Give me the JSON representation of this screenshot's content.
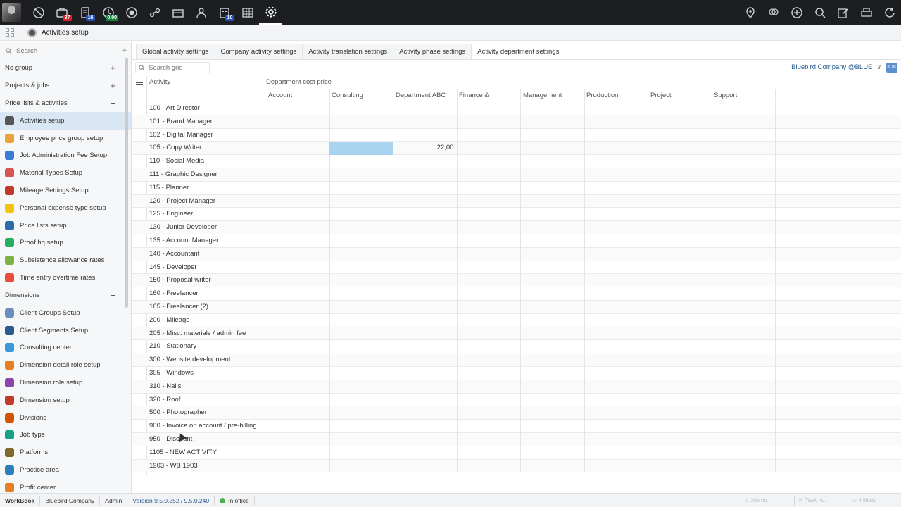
{
  "topbar": {
    "left_icons": [
      {
        "name": "dashboard-icon",
        "badge": "",
        "badge_color": ""
      },
      {
        "name": "jobs-icon",
        "badge": "37",
        "badge_color": "red"
      },
      {
        "name": "tasks-icon",
        "badge": "16",
        "badge_color": "blue"
      },
      {
        "name": "time-icon",
        "badge": "0,00",
        "badge_color": "green"
      },
      {
        "name": "target-icon",
        "badge": "",
        "badge_color": ""
      },
      {
        "name": "flow-icon",
        "badge": "",
        "badge_color": ""
      },
      {
        "name": "briefcase-icon",
        "badge": "",
        "badge_color": ""
      },
      {
        "name": "people-icon",
        "badge": "",
        "badge_color": ""
      },
      {
        "name": "building-icon",
        "badge": "10",
        "badge_color": "blue"
      },
      {
        "name": "table-icon",
        "badge": "",
        "badge_color": ""
      },
      {
        "name": "gear-icon",
        "badge": "",
        "badge_color": ""
      }
    ],
    "right_icons": [
      "location-icon",
      "brain-icon",
      "add-icon",
      "search-icon",
      "edit-icon",
      "print-icon",
      "refresh-icon"
    ]
  },
  "subbar": {
    "title": "Activities setup"
  },
  "sidebar": {
    "search_placeholder": "Search",
    "groups": [
      {
        "label": "No group",
        "toggle": "+",
        "items": []
      },
      {
        "label": "Projects & jobs",
        "toggle": "+",
        "items": []
      },
      {
        "label": "Price lists & activities",
        "toggle": "−",
        "items": [
          {
            "label": "Activities setup",
            "color": "#555555",
            "selected": true
          },
          {
            "label": "Employee price group setup",
            "color": "#e8a33a",
            "selected": false
          },
          {
            "label": "Job Administration Fee Setup",
            "color": "#3a7bd5",
            "selected": false
          },
          {
            "label": "Material Types Setup",
            "color": "#d9534f",
            "selected": false
          },
          {
            "label": "Mileage Settings Setup",
            "color": "#c0392b",
            "selected": false
          },
          {
            "label": "Personal expense type setup",
            "color": "#f1c40f",
            "selected": false
          },
          {
            "label": "Price lists setup",
            "color": "#2d6aa8",
            "selected": false
          },
          {
            "label": "Proof hq setup",
            "color": "#27ae60",
            "selected": false
          },
          {
            "label": "Subsistence allowance rates",
            "color": "#7cb342",
            "selected": false
          },
          {
            "label": "Time entry overtime rates",
            "color": "#e74c3c",
            "selected": false
          }
        ]
      },
      {
        "label": "Dimensions",
        "toggle": "−",
        "items": [
          {
            "label": "Client Groups Setup",
            "color": "#6c8ebf",
            "selected": false
          },
          {
            "label": "Client Segments Setup",
            "color": "#2a5d8f",
            "selected": false
          },
          {
            "label": "Consulting center",
            "color": "#3a9ad9",
            "selected": false
          },
          {
            "label": "Dimension detail role setup",
            "color": "#e67e22",
            "selected": false
          },
          {
            "label": "Dimension role setup",
            "color": "#8e44ad",
            "selected": false
          },
          {
            "label": "Dimension setup",
            "color": "#c0392b",
            "selected": false
          },
          {
            "label": "Divisions",
            "color": "#d35400",
            "selected": false
          },
          {
            "label": "Job type",
            "color": "#16a085",
            "selected": false
          },
          {
            "label": "Platforms",
            "color": "#7f6a2c",
            "selected": false
          },
          {
            "label": "Practice area",
            "color": "#2980b9",
            "selected": false
          },
          {
            "label": "Profit center",
            "color": "#e67e22",
            "selected": false
          }
        ]
      }
    ]
  },
  "tabs": [
    {
      "label": "Global activity settings",
      "active": false
    },
    {
      "label": "Company activity settings",
      "active": false
    },
    {
      "label": "Activity translation settings",
      "active": false
    },
    {
      "label": "Activity phase settings",
      "active": false
    },
    {
      "label": "Activity department settings",
      "active": true
    }
  ],
  "grid": {
    "search_placeholder": "Search grid",
    "company": "Bluebird Company @BLUE",
    "company_badge": "BLUE",
    "activity_header": "Activity",
    "group_header": "Department cost price",
    "columns": [
      "Account",
      "Consulting",
      "Department ABC",
      "Finance &",
      "Management",
      "Production",
      "Project",
      "Support"
    ],
    "rows": [
      {
        "activity": "100 - Art Director",
        "values": [
          "",
          "",
          "",
          "",
          "",
          "",
          "",
          ""
        ]
      },
      {
        "activity": "101 - Brand Manager",
        "values": [
          "",
          "",
          "",
          "",
          "",
          "",
          "",
          ""
        ]
      },
      {
        "activity": "102 - Digital Manager",
        "values": [
          "",
          "",
          "",
          "",
          "",
          "",
          "",
          ""
        ]
      },
      {
        "activity": "105 - Copy Writer",
        "values": [
          "",
          "",
          "22,00",
          "",
          "",
          "",
          "",
          ""
        ],
        "selected_col": 1
      },
      {
        "activity": "110 - Social Media",
        "values": [
          "",
          "",
          "",
          "",
          "",
          "",
          "",
          ""
        ]
      },
      {
        "activity": "111 - Graphic Designer",
        "values": [
          "",
          "",
          "",
          "",
          "",
          "",
          "",
          ""
        ]
      },
      {
        "activity": "115 - Planner",
        "values": [
          "",
          "",
          "",
          "",
          "",
          "",
          "",
          ""
        ]
      },
      {
        "activity": "120 - Project Manager",
        "values": [
          "",
          "",
          "",
          "",
          "",
          "",
          "",
          ""
        ]
      },
      {
        "activity": "125 - Engineer",
        "values": [
          "",
          "",
          "",
          "",
          "",
          "",
          "",
          ""
        ]
      },
      {
        "activity": "130 - Junior Developer",
        "values": [
          "",
          "",
          "",
          "",
          "",
          "",
          "",
          ""
        ]
      },
      {
        "activity": "135 - Account Manager",
        "values": [
          "",
          "",
          "",
          "",
          "",
          "",
          "",
          ""
        ]
      },
      {
        "activity": "140 - Accountant",
        "values": [
          "",
          "",
          "",
          "",
          "",
          "",
          "",
          ""
        ]
      },
      {
        "activity": "145 - Developer",
        "values": [
          "",
          "",
          "",
          "",
          "",
          "",
          "",
          ""
        ]
      },
      {
        "activity": "150 - Proposal writer",
        "values": [
          "",
          "",
          "",
          "",
          "",
          "",
          "",
          ""
        ]
      },
      {
        "activity": "160 - Freelancer",
        "values": [
          "",
          "",
          "",
          "",
          "",
          "",
          "",
          ""
        ]
      },
      {
        "activity": "165 - Freelancer (2)",
        "values": [
          "",
          "",
          "",
          "",
          "",
          "",
          "",
          ""
        ]
      },
      {
        "activity": "200 - Mileage",
        "values": [
          "",
          "",
          "",
          "",
          "",
          "",
          "",
          ""
        ]
      },
      {
        "activity": "205 - Misc. materials / admin fee",
        "values": [
          "",
          "",
          "",
          "",
          "",
          "",
          "",
          ""
        ]
      },
      {
        "activity": "210 - Stationary",
        "values": [
          "",
          "",
          "",
          "",
          "",
          "",
          "",
          ""
        ]
      },
      {
        "activity": "300 - Website development",
        "values": [
          "",
          "",
          "",
          "",
          "",
          "",
          "",
          ""
        ]
      },
      {
        "activity": "305 - Windows",
        "values": [
          "",
          "",
          "",
          "",
          "",
          "",
          "",
          ""
        ]
      },
      {
        "activity": "310 - Nails",
        "values": [
          "",
          "",
          "",
          "",
          "",
          "",
          "",
          ""
        ]
      },
      {
        "activity": "320 - Roof",
        "values": [
          "",
          "",
          "",
          "",
          "",
          "",
          "",
          ""
        ]
      },
      {
        "activity": "500 - Photographer",
        "values": [
          "",
          "",
          "",
          "",
          "",
          "",
          "",
          ""
        ]
      },
      {
        "activity": "900 - Invoice on account / pre-billing",
        "values": [
          "",
          "",
          "",
          "",
          "",
          "",
          "",
          ""
        ]
      },
      {
        "activity": "950 - Discount",
        "values": [
          "",
          "",
          "",
          "",
          "",
          "",
          "",
          ""
        ]
      },
      {
        "activity": "1105 - NEW ACTIVITY",
        "values": [
          "",
          "",
          "",
          "",
          "",
          "",
          "",
          ""
        ]
      },
      {
        "activity": "1903 - WB 1903",
        "values": [
          "",
          "",
          "",
          "",
          "",
          "",
          "",
          ""
        ]
      }
    ]
  },
  "statusbar": {
    "app": "WorkBook",
    "company": "Bluebird Company",
    "user": "Admin",
    "version": "Version 9.5.0.252 / 9.5.0.240",
    "status": "In office",
    "job_placeholder": "Job no.",
    "task_placeholder": "Task no.",
    "initials_placeholder": "Initials"
  }
}
